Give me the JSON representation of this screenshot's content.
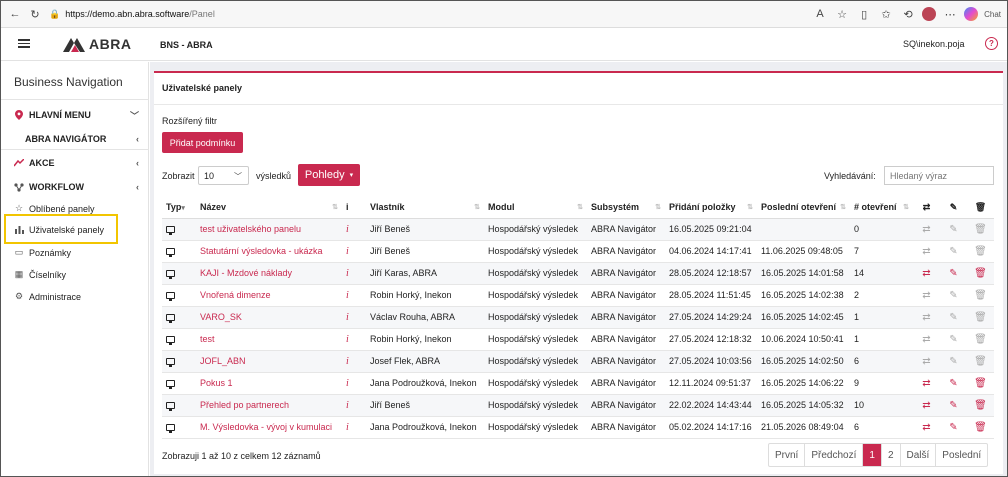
{
  "browser": {
    "url_domain": "https://demo.abn.abra.software",
    "url_path": "/Panel",
    "right_label": "Chat"
  },
  "header": {
    "logo_text": "ABRA",
    "company": "BNS - ABRA",
    "user": "SQ\\inekon.poja",
    "help": "?"
  },
  "sidebar": {
    "title": "Business Navigation",
    "main_menu": "HLAVNÍ MENU",
    "abra_nav": "ABRA NAVIGÁTOR",
    "akce": "AKCE",
    "workflow": "WORKFLOW",
    "items": [
      "Oblíbené panely",
      "Uživatelské panely",
      "Poznámky",
      "Číselníky",
      "Administrace"
    ]
  },
  "panel": {
    "title": "Uživatelské panely",
    "filter_label": "Rozšířený filtr",
    "add_condition": "Přidat podmínku",
    "show_label": "Zobrazit",
    "show_value": "10",
    "results_label": "výsledků",
    "views_button": "Pohledy",
    "search_label": "Vyhledávání:",
    "search_placeholder": "Hledaný výraz",
    "footer_info": "Zobrazuji 1 až 10 z celkem 12 záznamů"
  },
  "table": {
    "headers": {
      "type": "Typ",
      "name": "Název",
      "info": "i",
      "owner": "Vlastník",
      "module": "Modul",
      "subsystem": "Subsystém",
      "added": "Přidání položky",
      "last_open": "Poslední otevření",
      "opens": "# otevření"
    },
    "rows": [
      {
        "name": "test uživatelského panelu",
        "owner": "Jiří Beneš",
        "module": "Hospodářský výsledek",
        "subsystem": "ABRA Navigátor",
        "added": "16.05.2025 09:21:04",
        "last": "",
        "count": "0",
        "active": false
      },
      {
        "name": "Statutární výsledovka - ukázka",
        "owner": "Jiří Beneš",
        "module": "Hospodářský výsledek",
        "subsystem": "ABRA Navigátor",
        "added": "04.06.2024 14:17:41",
        "last": "11.06.2025 09:48:05",
        "count": "7",
        "active": false
      },
      {
        "name": "KAJI - Mzdové náklady",
        "owner": "Jiří Karas, ABRA",
        "module": "Hospodářský výsledek",
        "subsystem": "ABRA Navigátor",
        "added": "28.05.2024 12:18:57",
        "last": "16.05.2025 14:01:58",
        "count": "14",
        "active": true
      },
      {
        "name": "Vnořená dimenze",
        "owner": "Robin Horký, Inekon",
        "module": "Hospodářský výsledek",
        "subsystem": "ABRA Navigátor",
        "added": "28.05.2024 11:51:45",
        "last": "16.05.2025 14:02:38",
        "count": "2",
        "active": false
      },
      {
        "name": "VARO_SK",
        "owner": "Václav Rouha, ABRA",
        "module": "Hospodářský výsledek",
        "subsystem": "ABRA Navigátor",
        "added": "27.05.2024 14:29:24",
        "last": "16.05.2025 14:02:45",
        "count": "1",
        "active": false
      },
      {
        "name": "test",
        "owner": "Robin Horký, Inekon",
        "module": "Hospodářský výsledek",
        "subsystem": "ABRA Navigátor",
        "added": "27.05.2024 12:18:32",
        "last": "10.06.2024 10:50:41",
        "count": "1",
        "active": false
      },
      {
        "name": "JOFL_ABN",
        "owner": "Josef Flek, ABRA",
        "module": "Hospodářský výsledek",
        "subsystem": "ABRA Navigátor",
        "added": "27.05.2024 10:03:56",
        "last": "16.05.2025 14:02:50",
        "count": "6",
        "active": false
      },
      {
        "name": "Pokus 1",
        "owner": "Jana Podroužková, Inekon",
        "module": "Hospodářský výsledek",
        "subsystem": "ABRA Navigátor",
        "added": "12.11.2024 09:51:37",
        "last": "16.05.2025 14:06:22",
        "count": "9",
        "active": true
      },
      {
        "name": "Přehled po partnerech",
        "owner": "Jiří Beneš",
        "module": "Hospodářský výsledek",
        "subsystem": "ABRA Navigátor",
        "added": "22.02.2024 14:43:44",
        "last": "16.05.2025 14:05:32",
        "count": "10",
        "active": true
      },
      {
        "name": "M. Výsledovka - vývoj v kumulaci",
        "owner": "Jana Podroužková, Inekon",
        "module": "Hospodářský výsledek",
        "subsystem": "ABRA Navigátor",
        "added": "05.02.2024 14:17:16",
        "last": "21.05.2026 08:49:04",
        "count": "6",
        "active": true
      }
    ]
  },
  "pager": {
    "first": "První",
    "prev": "Předchozí",
    "p1": "1",
    "p2": "2",
    "next": "Další",
    "last": "Poslední"
  },
  "colors": {
    "accent": "#c9294f",
    "highlight": "#f2c500"
  }
}
